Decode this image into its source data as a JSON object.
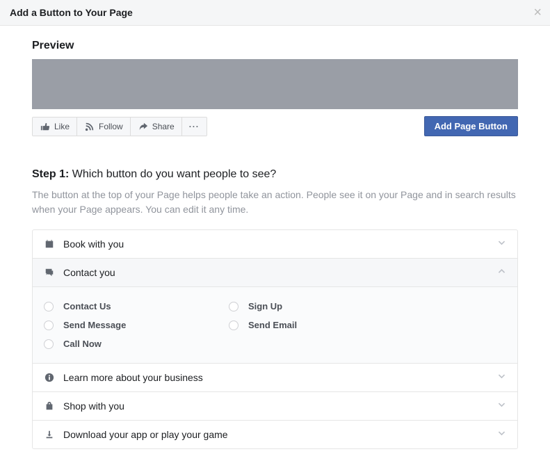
{
  "header": {
    "title": "Add a Button to Your Page"
  },
  "preview": {
    "title": "Preview",
    "like": "Like",
    "follow": "Follow",
    "share": "Share",
    "cta": "Add Page Button"
  },
  "step": {
    "label": "Step 1:",
    "question": "Which button do you want people to see?",
    "desc": "The button at the top of your Page helps people take an action. People see it on your Page and in search results when your Page appears. You can edit it any time."
  },
  "sections": {
    "book": "Book with you",
    "contact": "Contact you",
    "learn": "Learn more about your business",
    "shop": "Shop with you",
    "download": "Download your app or play your game"
  },
  "contact_options": {
    "contact_us": "Contact Us",
    "sign_up": "Sign Up",
    "send_message": "Send Message",
    "send_email": "Send Email",
    "call_now": "Call Now"
  }
}
